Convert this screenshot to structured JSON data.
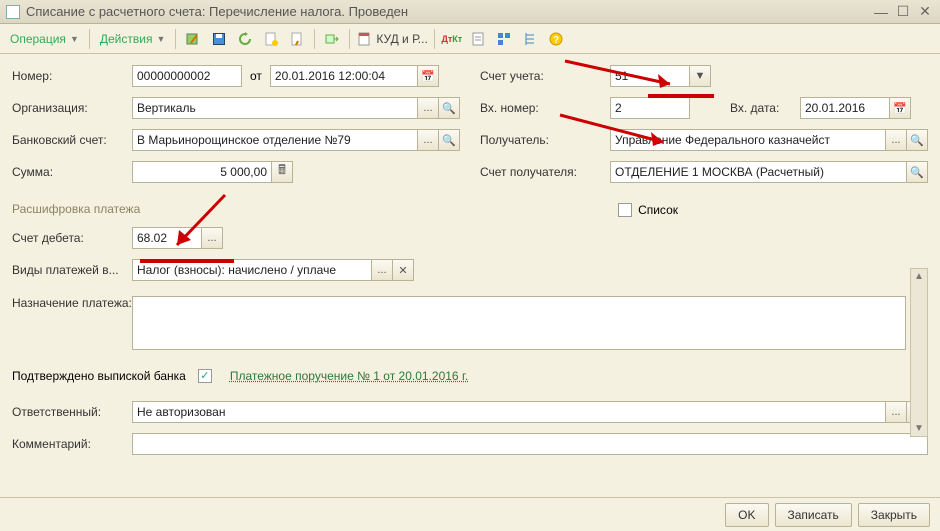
{
  "window": {
    "title": "Списание с расчетного счета: Перечисление налога. Проведен"
  },
  "toolbar": {
    "operation": "Операция",
    "actions": "Действия",
    "kud": "КУД и Р..."
  },
  "left": {
    "number_label": "Номер:",
    "number_value": "00000000002",
    "ot": "от",
    "date_value": "20.01.2016 12:00:04",
    "org_label": "Организация:",
    "org_value": "Вертикаль",
    "bank_label": "Банковский счет:",
    "bank_value": "В Марьинорощинское отделение №79",
    "sum_label": "Сумма:",
    "sum_value": "5 000,00"
  },
  "right": {
    "acc_label": "Счет учета:",
    "acc_value": "51",
    "vx_num_label": "Вх. номер:",
    "vx_num_value": "2",
    "vx_date_label": "Вх. дата:",
    "vx_date_value": "20.01.2016",
    "recipient_label": "Получатель:",
    "recipient_value": "Управление Федерального казначейст",
    "recacc_label": "Счет получателя:",
    "recacc_value": "ОТДЕЛЕНИЕ 1 МОСКВА (Расчетный)"
  },
  "payment": {
    "section": "Расшифровка платежа",
    "list_label": "Список",
    "debit_label": "Счет дебета:",
    "debit_value": "68.02",
    "types_label": "Виды платежей в...",
    "types_value": "Налог (взносы): начислено / уплаче",
    "purpose_label": "Назначение платежа:"
  },
  "confirm": {
    "label": "Подтверждено выпиской банка",
    "link": "Платежное поручение № 1 от 20.01.2016 г."
  },
  "bottom": {
    "responsible_label": "Ответственный:",
    "responsible_value": "Не авторизован",
    "comment_label": "Комментарий:"
  },
  "footer": {
    "ok": "OK",
    "write": "Записать",
    "close": "Закрыть"
  }
}
